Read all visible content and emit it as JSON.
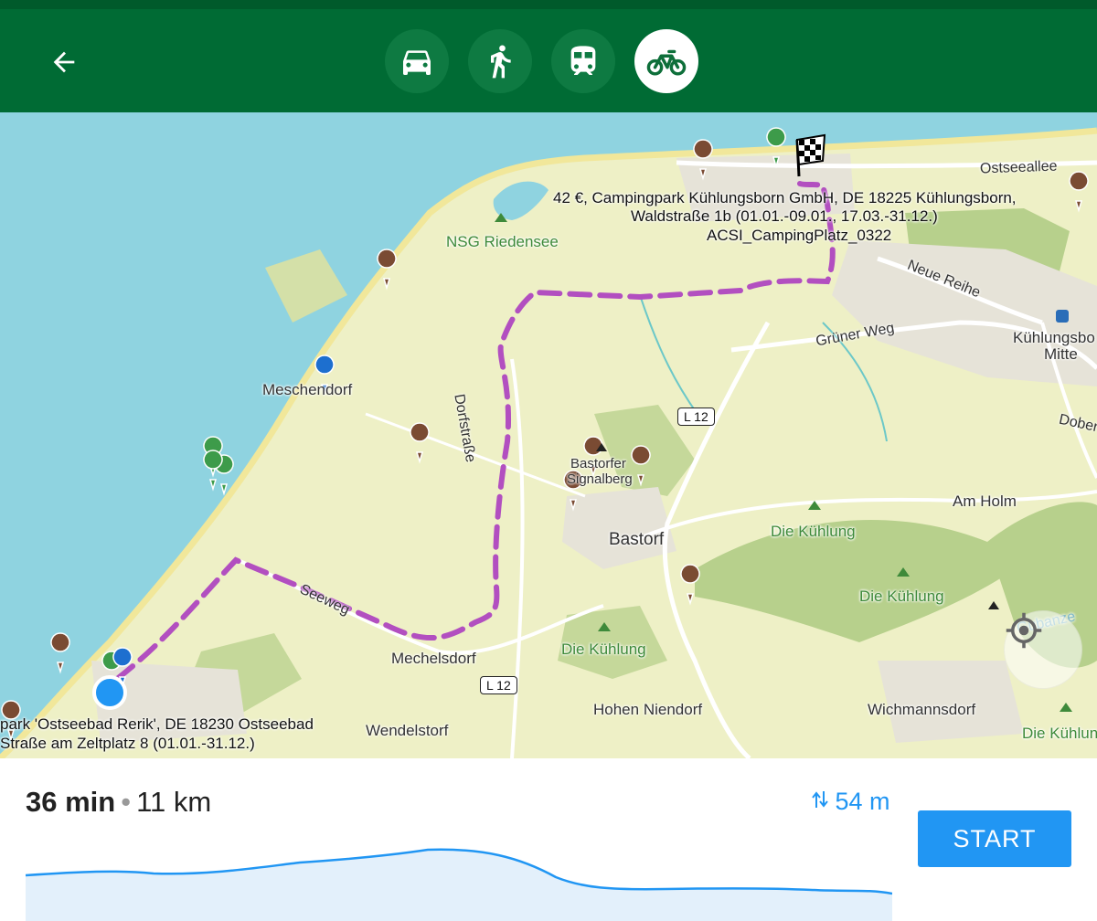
{
  "header": {
    "back_icon": "arrow-left-icon",
    "modes": [
      {
        "icon": "car-icon",
        "active": false
      },
      {
        "icon": "walk-icon",
        "active": false
      },
      {
        "icon": "train-icon",
        "active": false
      },
      {
        "icon": "bike-icon",
        "active": true
      }
    ],
    "color": "#006b34"
  },
  "map": {
    "destination_popup": {
      "line1": "42 €, Campingpark Kühlungsborn GmbH, DE 18225 Kühlungsborn,",
      "line2": "Waldstraße 1b (01.01.-09.01., 17.03.-31.12.)",
      "line3": "ACSI_CampingPlatz_0322"
    },
    "start_popup": {
      "line1": "park 'Ostseebad Rerik', DE 18230 Ostseebad",
      "line2": "Straße am Zeltplatz 8 (01.01.-31.12.)"
    },
    "places": {
      "nsg": "NSG Riedensee",
      "meschendorf": "Meschendorf",
      "bastorfer1": "Bastorfer",
      "bastorfer2": "Signalberg",
      "bastorf": "Bastorf",
      "kuehlung1": "Die Kühlung",
      "kuehlung2": "Die Kühlung",
      "kuehlung3": "Die Kühlung",
      "kuehlung4": "Die Kühlun",
      "mechelsdorf": "Mechelsdorf",
      "hohen": "Hohen Niendorf",
      "wichmann": "Wichmannsdorf",
      "wendelstorf": "Wendelstorf",
      "kborn1": "Kühlungsbo",
      "kborn2": "Mitte",
      "amholm": "Am Holm"
    },
    "roads": {
      "ostseeallee": "Ostseeallee",
      "neuereihe": "Neue Reihe",
      "gruenerweg": "Grüner Weg",
      "dorfstrasse": "Dorfstraße",
      "seeweg": "Seeweg",
      "dober": "Dober",
      "l12a": "L 12",
      "l12b": "L 12",
      "gubanze": "Gubanze"
    },
    "route_color": "#b24fc0",
    "water_color": "#8fd3e0"
  },
  "summary": {
    "duration": "36 min",
    "distance": "11 km",
    "elevation": "54 m",
    "start_label": "START",
    "accent": "#2196f3"
  }
}
